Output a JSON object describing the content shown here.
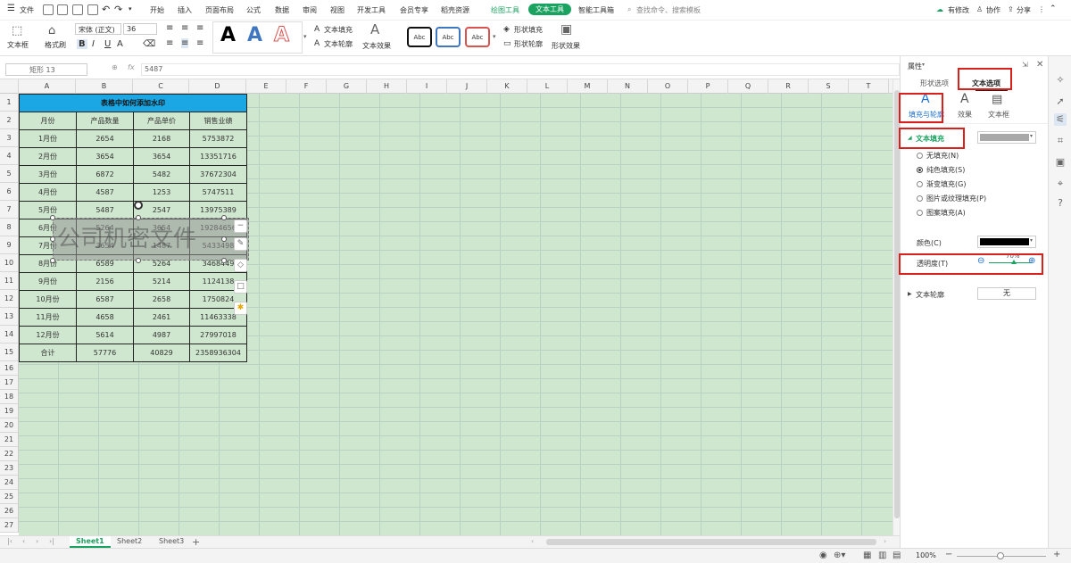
{
  "menu": {
    "file": "文件",
    "tabs": [
      "开始",
      "插入",
      "页面布局",
      "公式",
      "数据",
      "审阅",
      "视图",
      "开发工具",
      "会员专享",
      "稻壳资源",
      "绘图工具",
      "文本工具",
      "智能工具箱"
    ],
    "search": "查找命令、搜索模板",
    "modified": "有修改",
    "collab": "协作",
    "share": "分享"
  },
  "ribbon": {
    "textbox": "文本框",
    "format_painter": "格式刷",
    "font": "宋体 (正文)",
    "size": "36",
    "text_fill": "文本填充",
    "text_outline": "文本轮廓",
    "text_effect": "文本效果",
    "shape_fill": "形状填充",
    "shape_outline": "形状轮廓",
    "shape_effect": "形状效果",
    "art_glyph": "A",
    "style_abc": "Abc"
  },
  "formula_bar": {
    "name_box": "矩形 13",
    "fx": "fx",
    "value": "5487"
  },
  "columns": [
    "A",
    "B",
    "C",
    "D",
    "E",
    "F",
    "G",
    "H",
    "I",
    "J",
    "K",
    "L",
    "M",
    "N",
    "O",
    "P",
    "Q",
    "R",
    "S",
    "T"
  ],
  "rows": [
    "1",
    "2",
    "3",
    "4",
    "5",
    "6",
    "7",
    "8",
    "9",
    "10",
    "11",
    "12",
    "13",
    "14",
    "15",
    "16",
    "17",
    "18",
    "19",
    "20",
    "21",
    "22",
    "23",
    "24",
    "25",
    "26",
    "27"
  ],
  "table": {
    "title": "表格中如何添加水印",
    "headers": [
      "月份",
      "产品数量",
      "产品单价",
      "销售业绩"
    ],
    "rows": [
      [
        "1月份",
        "2654",
        "2168",
        "5753872"
      ],
      [
        "2月份",
        "3654",
        "3654",
        "13351716"
      ],
      [
        "3月份",
        "6872",
        "5482",
        "37672304"
      ],
      [
        "4月份",
        "4587",
        "1253",
        "5747511"
      ],
      [
        "5月份",
        "5487",
        "2547",
        "13975389"
      ],
      [
        "6月份",
        "5264",
        "3654",
        "19284656"
      ],
      [
        "7月份",
        "3654",
        "1487",
        "5433498"
      ],
      [
        "8月份",
        "6589",
        "5264",
        "3468449"
      ],
      [
        "9月份",
        "2156",
        "5214",
        "1124138"
      ],
      [
        "10月份",
        "6587",
        "2658",
        "1750824"
      ],
      [
        "11月份",
        "4658",
        "2461",
        "11463338"
      ],
      [
        "12月份",
        "5614",
        "4987",
        "27997018"
      ],
      [
        "合计",
        "57776",
        "40829",
        "2358936304"
      ]
    ]
  },
  "watermark": "公司机密文件",
  "sheets": [
    "Sheet1",
    "Sheet2",
    "Sheet3"
  ],
  "panel": {
    "title": "属性",
    "tab_shape": "形状选项",
    "tab_text": "文本选项",
    "sub_fill": "填充与轮廓",
    "sub_effect": "效果",
    "sub_textbox": "文本框",
    "section_fill": "文本填充",
    "opt_none": "无填充(N)",
    "opt_solid": "纯色填充(S)",
    "opt_gradient": "渐变填充(G)",
    "opt_picture": "图片或纹理填充(P)",
    "opt_pattern": "图案填充(A)",
    "color_label": "颜色(C)",
    "transparency_label": "透明度(T)",
    "transparency_value": "70%",
    "outline_label": "文本轮廓",
    "outline_value": "无"
  },
  "status": {
    "zoom": "100%"
  },
  "colors": {
    "accent": "#1aa260",
    "title_fill": "#1aa7e4",
    "grid_bg": "#cfe7cf",
    "highlight": "#d9201c",
    "text_color": "#000000",
    "fill_preview": "#a9a9a9"
  }
}
